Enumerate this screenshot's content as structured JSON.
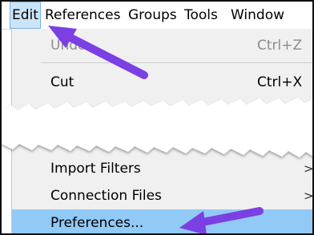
{
  "menubar": {
    "items": [
      "Edit",
      "References",
      "Groups",
      "Tools",
      "Window"
    ]
  },
  "edit_menu": {
    "undo": {
      "label": "Undo",
      "shortcut": "Ctrl+Z"
    },
    "cut": {
      "label": "Cut",
      "shortcut": "Ctrl+X"
    },
    "import_filters": {
      "label": "Import Filters",
      "submenu_arrow": ">"
    },
    "connection_files": {
      "label": "Connection Files",
      "submenu_arrow": ">"
    },
    "preferences": {
      "label": "Preferences..."
    }
  },
  "colors": {
    "menu_background": "#f0f0f0",
    "highlight": "#91c9f7",
    "menubar_active": "#cce4f7",
    "annotation_arrow": "#7b3fe4",
    "disabled_text": "#8d8d8d"
  }
}
